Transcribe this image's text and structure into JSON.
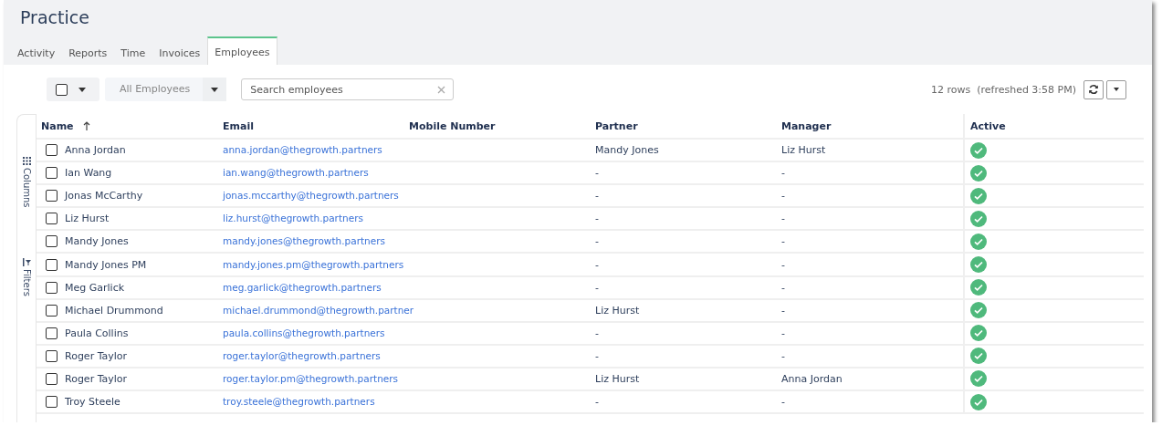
{
  "page": {
    "title": "Practice"
  },
  "tabs": [
    {
      "label": "Activity",
      "selected": false
    },
    {
      "label": "Reports",
      "selected": false
    },
    {
      "label": "Time",
      "selected": false
    },
    {
      "label": "Invoices",
      "selected": false
    },
    {
      "label": "Employees",
      "selected": true
    }
  ],
  "toolbar": {
    "select_all": {
      "checked": false
    },
    "filter": {
      "value": "All Employees"
    },
    "search": {
      "placeholder": "Search employees"
    },
    "status": "12 rows  (refreshed 3:58 PM)"
  },
  "side_panel": [
    {
      "label": "Columns",
      "kind": "columns"
    },
    {
      "label": "Filters",
      "kind": "filters"
    }
  ],
  "table": {
    "columns": [
      {
        "label": "Name",
        "sorted": true
      },
      {
        "label": "Email",
        "sorted": false
      },
      {
        "label": "Mobile Number",
        "sorted": false
      },
      {
        "label": "Partner",
        "sorted": false
      },
      {
        "label": "Manager",
        "sorted": false
      },
      {
        "label": "Active",
        "sorted": false
      }
    ],
    "rows": [
      {
        "checked": false,
        "name": "Anna Jordan",
        "email": "anna.jordan@thegrowth.partners",
        "partner": "Mandy Jones",
        "manager": "Liz Hurst",
        "active": true
      },
      {
        "checked": false,
        "name": "Ian Wang",
        "email": "ian.wang@thegrowth.partners",
        "partner": "-",
        "manager": "-",
        "active": true
      },
      {
        "checked": false,
        "name": "Jonas McCarthy",
        "email": "jonas.mccarthy@thegrowth.partners",
        "partner": "-",
        "manager": "-",
        "active": true
      },
      {
        "checked": false,
        "name": "Liz Hurst",
        "email": "liz.hurst@thegrowth.partners",
        "partner": "-",
        "manager": "-",
        "active": true
      },
      {
        "checked": false,
        "name": "Mandy Jones",
        "email": "mandy.jones@thegrowth.partners",
        "partner": "-",
        "manager": "-",
        "active": true
      },
      {
        "checked": false,
        "name": "Mandy Jones PM",
        "email": "mandy.jones.pm@thegrowth.partners",
        "partner": "-",
        "manager": "-",
        "active": true
      },
      {
        "checked": false,
        "name": "Meg Garlick",
        "email": "meg.garlick@thegrowth.partners",
        "partner": "-",
        "manager": "-",
        "active": true
      },
      {
        "checked": false,
        "name": "Michael Drummond",
        "email": "michael.drummond@thegrowth.partner",
        "partner": "Liz Hurst",
        "manager": "-",
        "active": true
      },
      {
        "checked": false,
        "name": "Paula Collins",
        "email": "paula.collins@thegrowth.partners",
        "partner": "-",
        "manager": "-",
        "active": true
      },
      {
        "checked": false,
        "name": "Roger Taylor",
        "email": "roger.taylor@thegrowth.partners",
        "partner": "-",
        "manager": "-",
        "active": true
      },
      {
        "checked": false,
        "name": "Roger Taylor",
        "email": "roger.taylor.pm@thegrowth.partners",
        "partner": "Liz Hurst",
        "manager": "Anna Jordan",
        "active": true
      },
      {
        "checked": false,
        "name": "Troy Steele",
        "email": "troy.steele@thegrowth.partners",
        "partner": "-",
        "manager": "-",
        "active": true
      }
    ]
  }
}
